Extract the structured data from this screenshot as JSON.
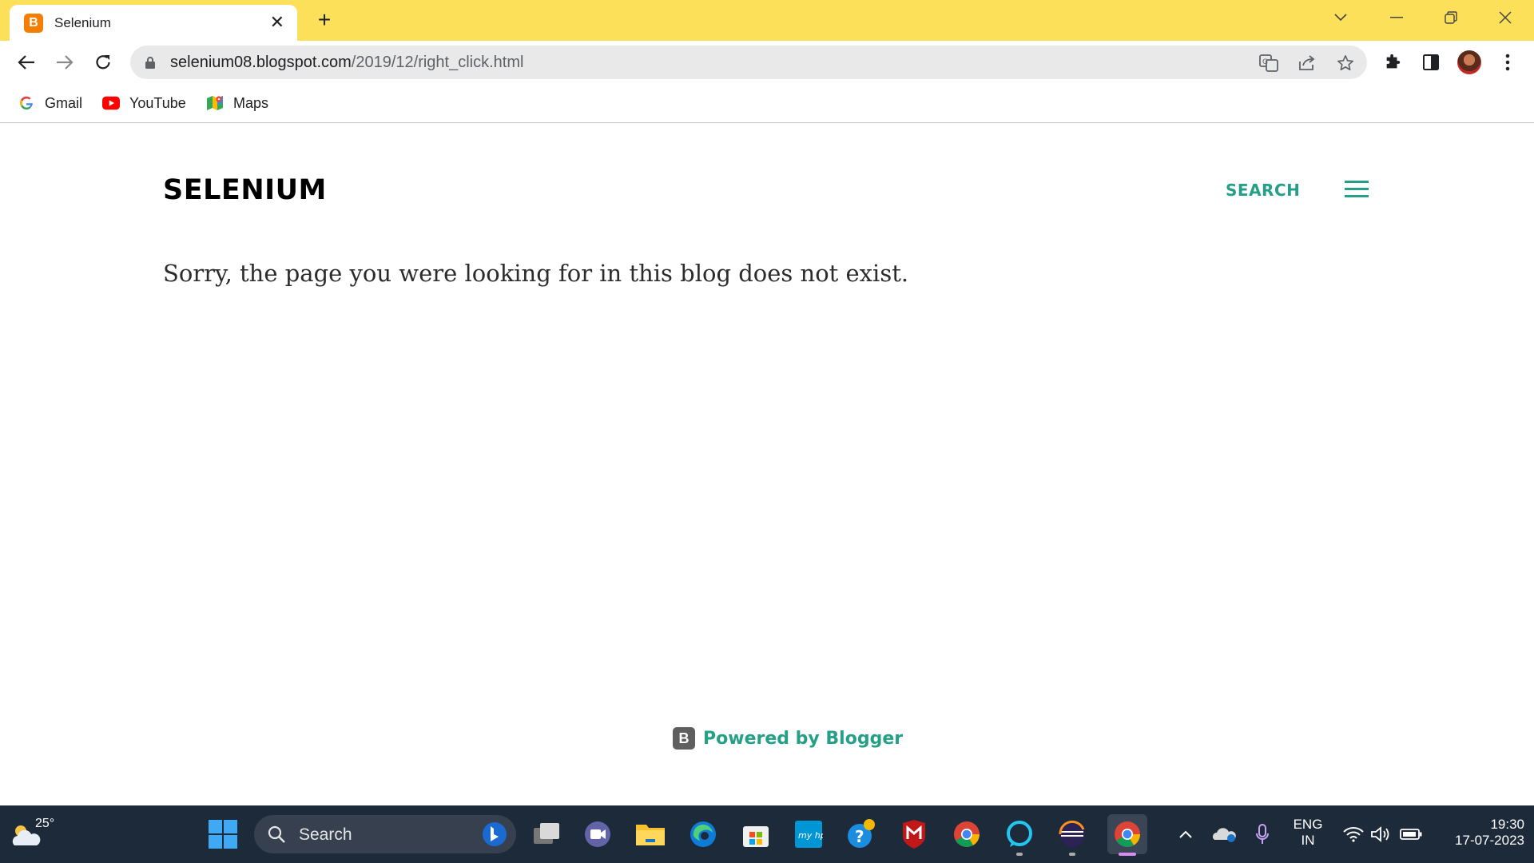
{
  "browser": {
    "tab_title": "Selenium",
    "url_host": "selenium08.blogspot.com",
    "url_path": "/2019/12/right_click.html"
  },
  "bookmarks": [
    {
      "label": "Gmail",
      "icon": "google-icon"
    },
    {
      "label": "YouTube",
      "icon": "youtube-icon"
    },
    {
      "label": "Maps",
      "icon": "maps-icon"
    }
  ],
  "page": {
    "site_title": "SELENIUM",
    "search_label": "SEARCH",
    "message": "Sorry, the page you were looking for in this blog does not exist.",
    "powered_by": "Powered by Blogger"
  },
  "taskbar": {
    "temperature": "25°",
    "search_placeholder": "Search",
    "language": "ENG",
    "region": "IN",
    "time": "19:30",
    "date": "17-07-2023"
  },
  "colors": {
    "titlebar": "#fde05a",
    "accent": "#269f87",
    "taskbar": "#1c2a3a"
  }
}
